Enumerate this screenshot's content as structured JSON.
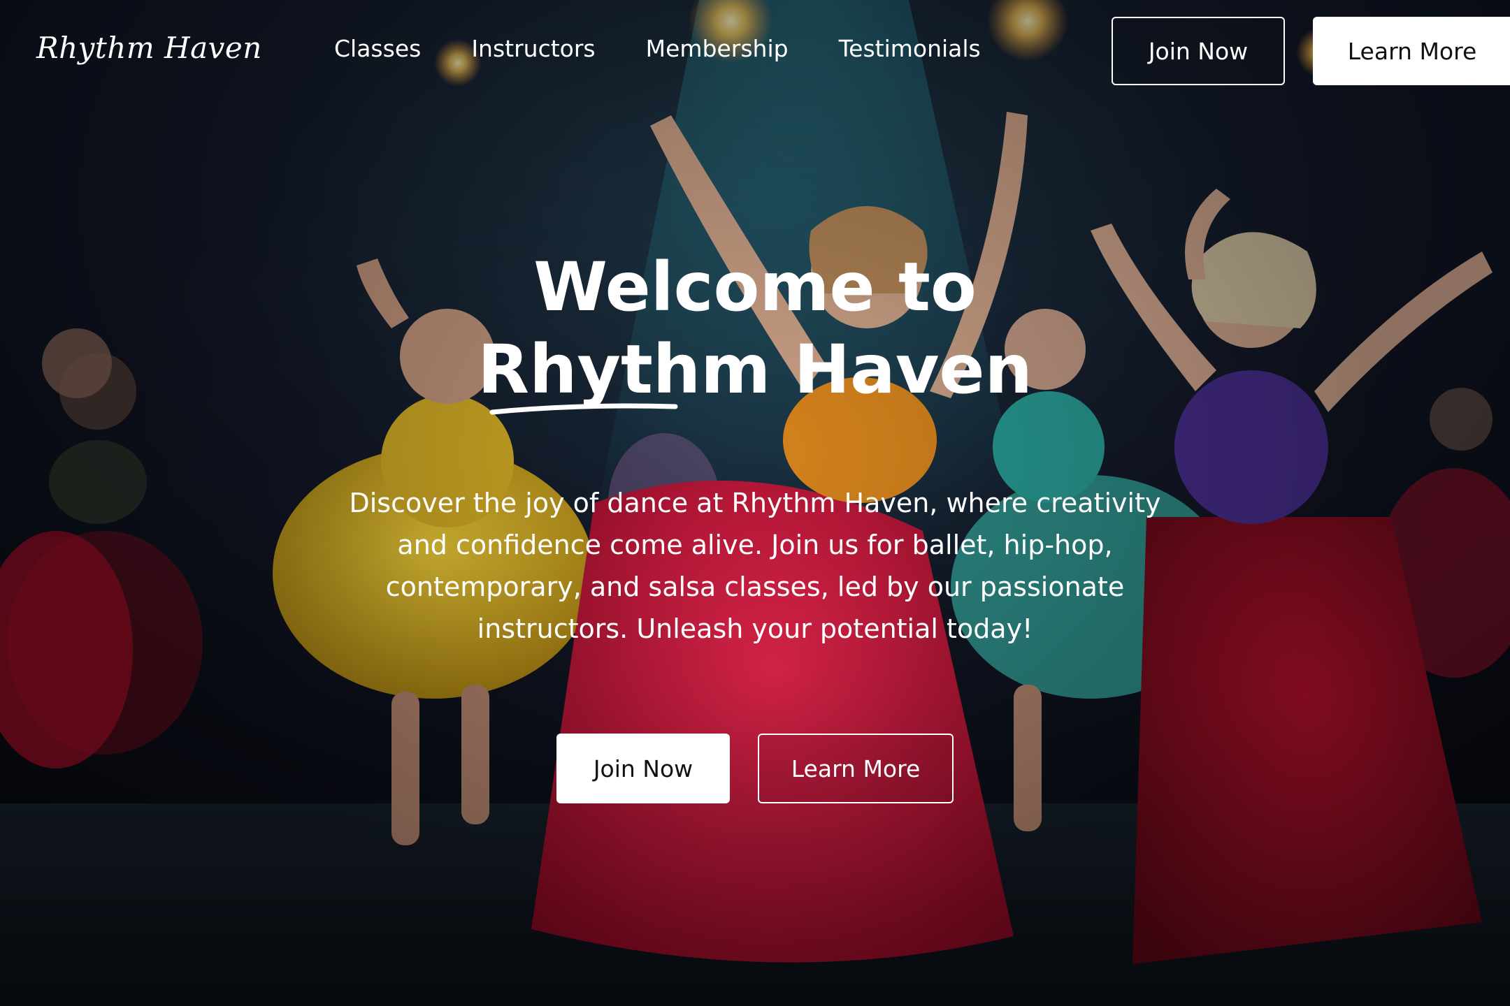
{
  "brand": {
    "logo_text": "Rhythm Haven"
  },
  "nav": {
    "links": [
      "Classes",
      "Instructors",
      "Membership",
      "Testimonials"
    ],
    "join_label": "Join Now",
    "learn_label": "Learn More"
  },
  "hero": {
    "headline_line1": "Welcome to",
    "headline_line2": "Rhythm Haven",
    "description": "Discover the joy of dance at Rhythm Haven, where creativity and confidence come alive. Join us for ballet, hip-hop, contemporary, and salsa classes, led by our passionate instructors. Unleash your potential today!",
    "cta_join_label": "Join Now",
    "cta_learn_label": "Learn More"
  },
  "colors": {
    "text": "#ffffff",
    "button_fill": "#ffffff",
    "button_text": "#111111",
    "background_dark": "#0b0d16",
    "stage_red": "#c8102e",
    "stage_yellow": "#e0b81f",
    "stage_teal": "#1f8c8c",
    "stage_purple": "#4b2d8c"
  }
}
